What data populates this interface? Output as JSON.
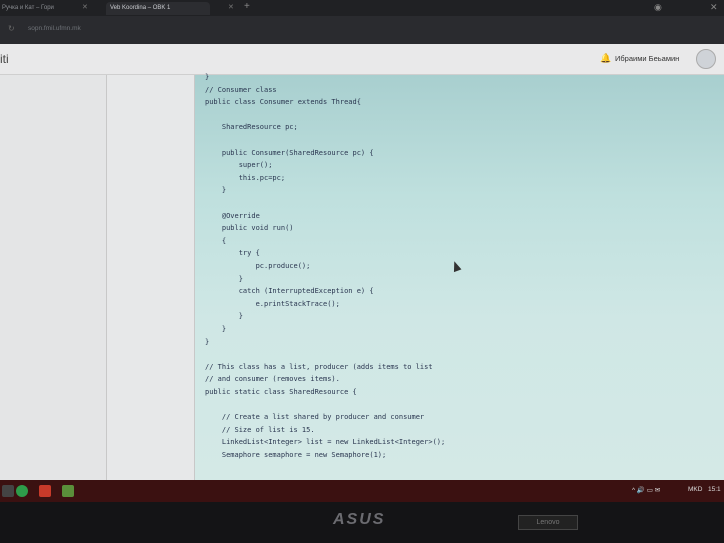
{
  "browser": {
    "tabs": [
      {
        "label": "Ручка и Кат – Гори",
        "active": false
      },
      {
        "label": "Veb Koordina – OBK 1",
        "active": true
      }
    ],
    "url": "sopn.fmil.ufmn.mk"
  },
  "app": {
    "brand": "iti",
    "user_name": "Ибраими Беьамин",
    "bell_icon": "bell-icon"
  },
  "code_lines": [
    "}",
    "// Consumer class",
    "public class Consumer extends Thread{",
    "",
    "    SharedResource pc;",
    "",
    "    public Consumer(SharedResource pc) {",
    "        super();",
    "        this.pc=pc;",
    "    }",
    "",
    "    @Override",
    "    public void run()",
    "    {",
    "        try {",
    "            pc.produce();",
    "        }",
    "        catch (InterruptedException e) {",
    "            e.printStackTrace();",
    "        }",
    "    }",
    "}",
    "",
    "// This class has a list, producer (adds items to list",
    "// and consumer (removes items).",
    "public static class SharedResource {",
    "",
    "    // Create a list shared by producer and consumer",
    "    // Size of list is 15.",
    "    LinkedList<Integer> list = new LinkedList<Integer>();",
    "    Semaphore semaphore = new Semaphore(1);"
  ],
  "taskbar": {
    "tray_lang": "MKD",
    "tray_time": "15:1"
  },
  "bezel": {
    "logo": "ASUS",
    "sticker": "Lenovo"
  }
}
